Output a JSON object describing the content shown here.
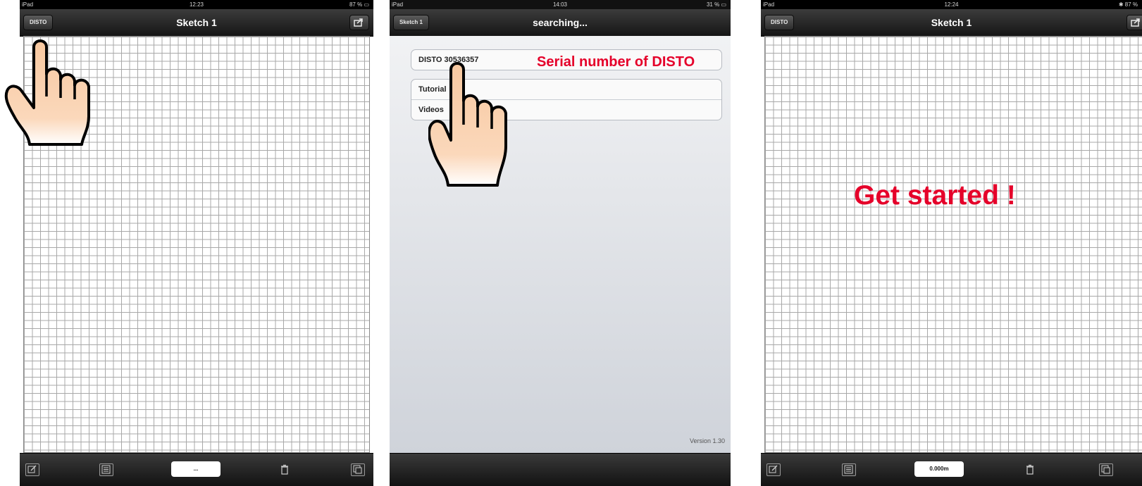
{
  "panel1": {
    "status": {
      "carrier": "iPad",
      "time": "12:23",
      "battery": "87 %"
    },
    "nav": {
      "title": "Sketch 1",
      "left_button": "DISTO"
    },
    "toolbar": {
      "field_value": "..."
    }
  },
  "panel2": {
    "status": {
      "carrier": "iPad",
      "time": "14:03",
      "battery": "31 %"
    },
    "nav": {
      "title": "searching...",
      "back_button": "Sketch 1"
    },
    "list": {
      "device": "DISTO 30536357",
      "items": [
        "Tutorial",
        "Videos"
      ]
    },
    "version": "Version 1.30"
  },
  "panel3": {
    "status": {
      "carrier": "iPad",
      "time": "12:24",
      "battery": "87 %"
    },
    "nav": {
      "title": "Sketch 1",
      "left_button": "DISTO"
    },
    "toolbar": {
      "field_value": "0.000m"
    }
  },
  "annotations": {
    "serial": "Serial number of DISTO",
    "get_started": "Get started !"
  },
  "colors": {
    "annotation": "#e5002a",
    "bar_dark": "#1a1a1a",
    "grid_line": "#a8a8a8"
  },
  "icons": [
    "share-icon",
    "edit-icon",
    "list-icon",
    "trash-icon",
    "layers-icon",
    "pointing-hand-icon",
    "bluetooth-icon",
    "battery-icon"
  ]
}
